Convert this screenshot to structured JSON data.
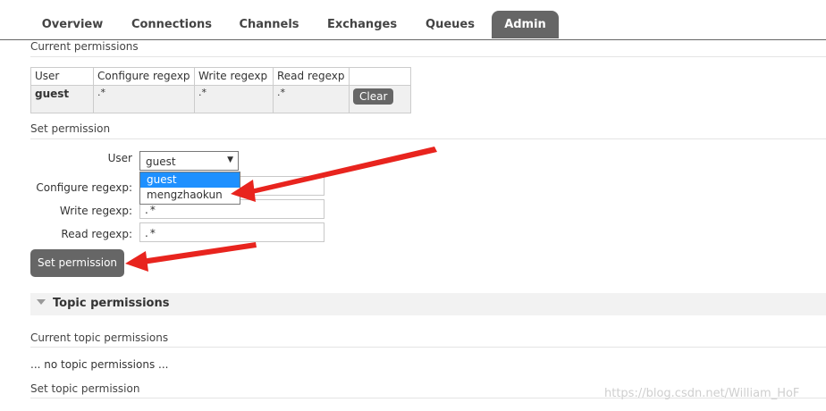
{
  "tabs": [
    {
      "label": "Overview"
    },
    {
      "label": "Connections"
    },
    {
      "label": "Channels"
    },
    {
      "label": "Exchanges"
    },
    {
      "label": "Queues"
    },
    {
      "label": "Admin"
    }
  ],
  "current_permissions": {
    "heading": "Current permissions",
    "columns": [
      "User",
      "Configure regexp",
      "Write regexp",
      "Read regexp"
    ],
    "row": {
      "user": "guest",
      "configure": ".*",
      "write": ".*",
      "read": ".*",
      "clear_label": "Clear"
    }
  },
  "set_permission": {
    "heading": "Set permission",
    "user_label": "User",
    "user_value": "guest",
    "user_options": [
      "guest",
      "mengzhaokun"
    ],
    "configure_label": "Configure regexp:",
    "configure_value": ".*",
    "write_label": "Write regexp:",
    "write_value": ".*",
    "read_label": "Read regexp:",
    "read_value": ".*",
    "button_label": "Set permission"
  },
  "topic_permissions": {
    "title": "Topic permissions",
    "current_heading": "Current topic permissions",
    "empty_text": "... no topic permissions ...",
    "set_heading": "Set topic permission"
  },
  "watermark": "https://blog.csdn.net/William_HoF",
  "colors": {
    "tab_active": "#666666",
    "button": "#666666",
    "arrow": "#e8241e",
    "selected_option": "#1e90ff"
  }
}
